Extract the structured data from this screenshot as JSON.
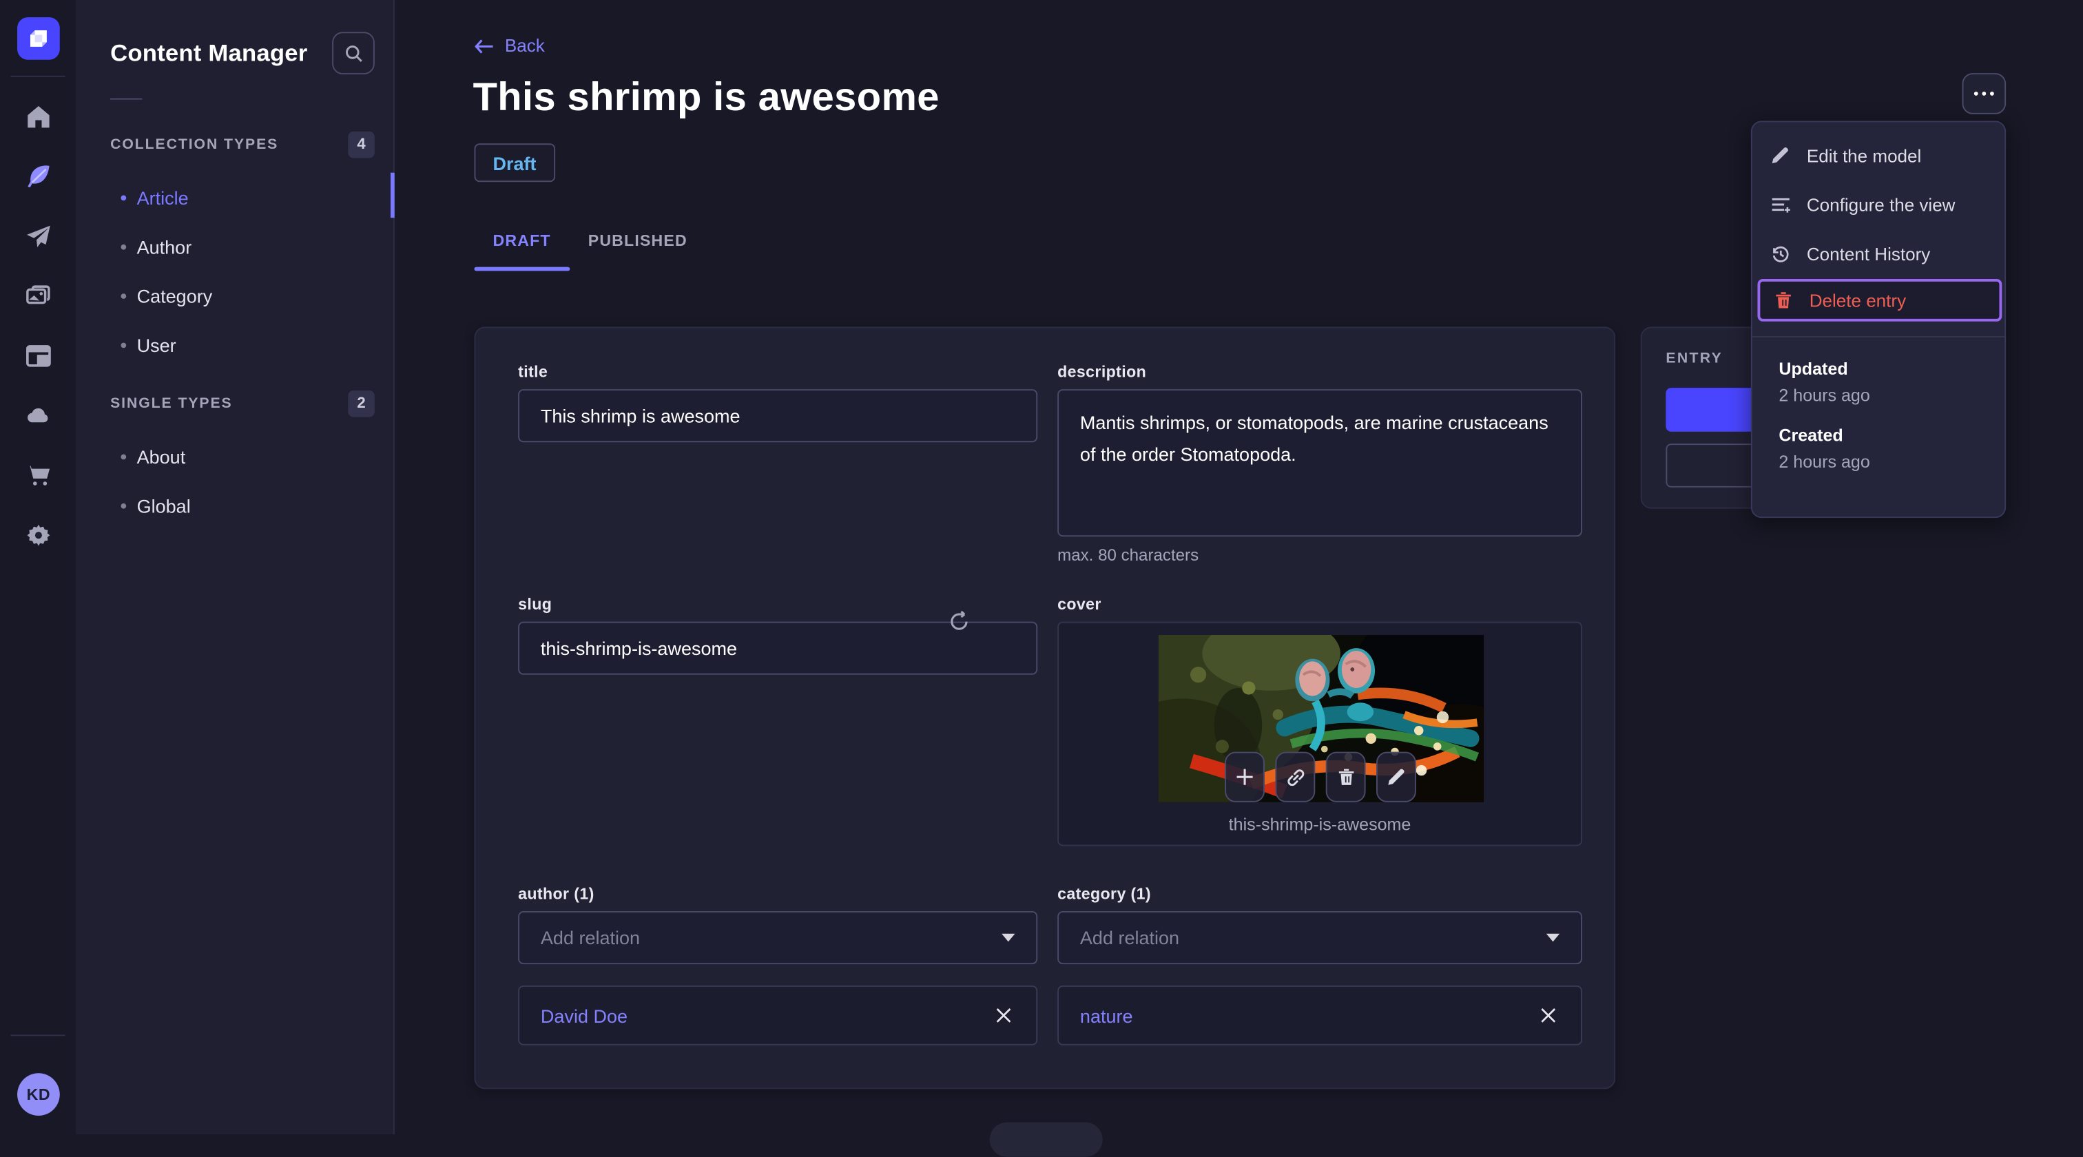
{
  "app": {
    "name": "Strapi",
    "page_title": "Content Manager"
  },
  "primary_nav": {
    "items": [
      {
        "icon": "home-icon"
      },
      {
        "icon": "feather-icon",
        "active": true
      },
      {
        "icon": "paper-plane-icon"
      },
      {
        "icon": "media-library-icon"
      },
      {
        "icon": "layout-icon"
      },
      {
        "icon": "cloud-icon"
      },
      {
        "icon": "cart-icon"
      },
      {
        "icon": "gear-icon"
      }
    ],
    "avatar_initials": "KD"
  },
  "secondary_nav": {
    "title": "Content Manager",
    "sections": [
      {
        "label": "COLLECTION TYPES",
        "count": "4",
        "items": [
          {
            "label": "Article",
            "active": true
          },
          {
            "label": "Author"
          },
          {
            "label": "Category"
          },
          {
            "label": "User"
          }
        ]
      },
      {
        "label": "SINGLE TYPES",
        "count": "2",
        "items": [
          {
            "label": "About"
          },
          {
            "label": "Global"
          }
        ]
      }
    ]
  },
  "header": {
    "back_label": "Back",
    "title": "This shrimp is awesome",
    "status_badge": "Draft",
    "tabs": [
      {
        "label": "DRAFT",
        "active": true
      },
      {
        "label": "PUBLISHED",
        "active": false
      }
    ]
  },
  "form": {
    "title": {
      "label": "title",
      "value": "This shrimp is awesome"
    },
    "description": {
      "label": "description",
      "value": "Mantis shrimps, or stomatopods, are marine crustaceans of the order Stomatopoda.",
      "hint": "max. 80 characters"
    },
    "slug": {
      "label": "slug",
      "value": "this-shrimp-is-awesome"
    },
    "cover": {
      "label": "cover",
      "caption": "this-shrimp-is-awesome",
      "actions": [
        "plus-icon",
        "link-icon",
        "trash-icon",
        "pencil-icon"
      ]
    },
    "author": {
      "label": "author (1)",
      "placeholder": "Add relation",
      "relation": "David Doe"
    },
    "category": {
      "label": "category (1)",
      "placeholder": "Add relation",
      "relation": "nature"
    }
  },
  "entry_panel": {
    "title": "ENTRY"
  },
  "context_menu": {
    "items": [
      {
        "label": "Edit the model",
        "icon": "pencil-icon"
      },
      {
        "label": "Configure the view",
        "icon": "list-plus-icon"
      },
      {
        "label": "Content History",
        "icon": "history-icon"
      },
      {
        "label": "Delete entry",
        "icon": "trash-icon",
        "danger": true,
        "focused": true
      }
    ],
    "meta": [
      {
        "label": "Updated",
        "value": "2 hours ago"
      },
      {
        "label": "Created",
        "value": "2 hours ago"
      }
    ]
  },
  "colors": {
    "accent": "#4945ff",
    "link": "#7b79ff",
    "danger": "#ee5e52",
    "draft_status": "#66b7f1",
    "focus_ring": "#9767f0"
  }
}
